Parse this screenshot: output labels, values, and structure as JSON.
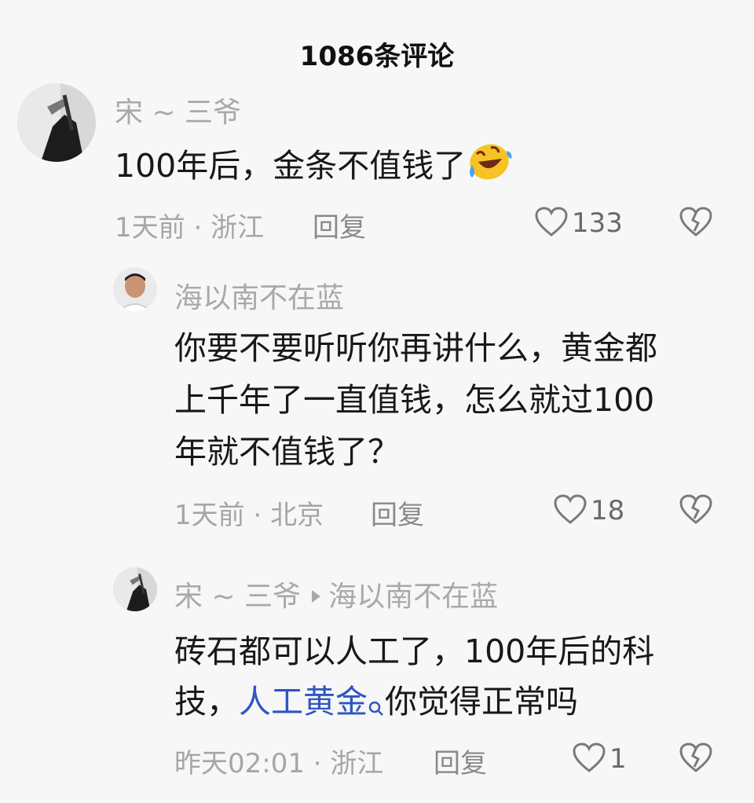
{
  "header": {
    "title": "1086条评论"
  },
  "comments": [
    {
      "user": "宋 ~ 三爷",
      "text": "100年后，金条不值钱了",
      "time": "1天前",
      "location": "浙江",
      "reply_label": "回复",
      "likes": "133"
    },
    {
      "user": "海以南不在蓝",
      "lines": [
        "你要不要听听你再讲什么，黄金都",
        "上千年了一直值钱，怎么就过100",
        "年就不值钱了？"
      ],
      "time": "1天前",
      "location": "北京",
      "reply_label": "回复",
      "likes": "18"
    },
    {
      "user": "宋 ~ 三爷",
      "reply_to": "海以南不在蓝",
      "line1": "砖石都可以人工了，100年后的科",
      "line2_pre": "技，",
      "line2_link": "人工黄金",
      "line2_post": "你觉得正常吗",
      "time": "昨天02:01",
      "location": "浙江",
      "reply_label": "回复",
      "likes": "1"
    }
  ],
  "separator": "·",
  "icons": {
    "like": "heart-outline-icon",
    "dislike": "broken-heart-icon",
    "search": "search-icon",
    "emoji": "rofl-emoji-icon"
  },
  "colors": {
    "link": "#2f55c4",
    "muted": "#a6a6a6",
    "text": "#181818"
  }
}
